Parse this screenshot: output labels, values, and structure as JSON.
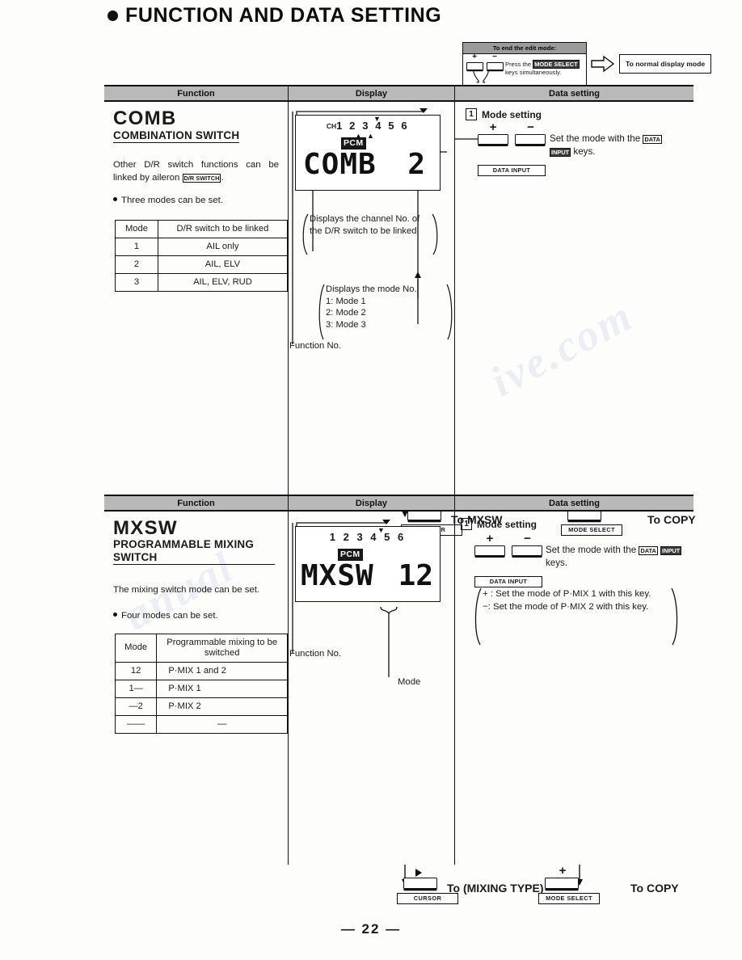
{
  "page": {
    "title": "FUNCTION AND DATA SETTING",
    "page_number": "— 22 —",
    "watermark": "chanialive.com"
  },
  "end_edit_note": {
    "header": "To end the edit mode:",
    "line1_pre": "Press the",
    "key_label": "MODE SELECT",
    "line2": "keys simultaneously.",
    "plus": "+",
    "minus": "−",
    "result_box": "To normal display mode"
  },
  "columns": {
    "function": "Function",
    "display": "Display",
    "data_setting": "Data setting"
  },
  "sections": [
    {
      "code": "COMB",
      "name": "COMBINATION SWITCH",
      "description": "Other D/R switch functions can be linked by aileron",
      "description_key": "D/R SWITCH",
      "description_tail": ".",
      "bullet": "Three modes can be set.",
      "mode_table": {
        "headers": [
          "Mode",
          "D/R switch to be linked"
        ],
        "rows": [
          [
            "1",
            "AIL only"
          ],
          [
            "2",
            "AIL, ELV"
          ],
          [
            "3",
            "AIL, ELV, RUD"
          ]
        ]
      },
      "lcd": {
        "ch_tag": "CH",
        "channels": "1 2 3 4 5 6",
        "pcm": "PCM",
        "segment_name": "COMB",
        "segment_value": "2"
      },
      "callouts": [
        "Displays the channel No. of the D/R switch to be linked.",
        "Displays the mode No.\n1: Mode 1\n2: Mode 2\n3: Mode 3"
      ],
      "function_no_label": "Function No.",
      "mode_pointer_label": "",
      "data_setting": {
        "step_number": "1",
        "step_label": "Mode setting",
        "plus": "+",
        "minus": "−",
        "key_label": "DATA INPUT",
        "instruction_pre": "Set the mode with the",
        "instruction_key1": "DATA",
        "instruction_key2": "INPUT",
        "instruction_tail": "keys.",
        "extra_note": ""
      },
      "nav": {
        "cursor_label": "CURSOR",
        "cursor_to": "To MXSW",
        "mode_select_sign": "+",
        "mode_select_label": "MODE SELECT",
        "mode_select_to": "To COPY"
      }
    },
    {
      "code": "MXSW",
      "name": "PROGRAMMABLE MIXING SWITCH",
      "description": "The mixing switch mode can be set.",
      "description_key": "",
      "description_tail": "",
      "bullet": "Four modes can be set.",
      "mode_table": {
        "headers": [
          "Mode",
          "Programmable mixing to be switched"
        ],
        "rows": [
          [
            "12",
            "P·MIX 1 and 2"
          ],
          [
            "1—",
            "P·MIX 1"
          ],
          [
            "—2",
            "P·MIX 2"
          ],
          [
            "——",
            "—"
          ]
        ]
      },
      "lcd": {
        "ch_tag": "",
        "channels": "1 2 3 4 5 6",
        "pcm": "PCM",
        "segment_name": "MXSW",
        "segment_value": "12"
      },
      "callouts": [
        "+ : Set the mode of P·MIX 1 with this key.\n− : Set the mode of P·MIX 2 with this key."
      ],
      "function_no_label": "Function No.",
      "mode_pointer_label": "Mode",
      "data_setting": {
        "step_number": "1",
        "step_label": "Mode setting",
        "plus": "+",
        "minus": "−",
        "key_label": "DATA INPUT",
        "instruction_pre": "Set the mode with the",
        "instruction_key1": "DATA",
        "instruction_key2": "INPUT",
        "instruction_tail": "keys.",
        "note_plus": "+ : Set the mode of P·MIX 1 with this key.",
        "note_minus": "−: Set the mode of P·MIX 2 with this key."
      },
      "nav": {
        "cursor_label": "CURSOR",
        "cursor_to": "To (MIXING TYPE)",
        "mode_select_sign": "+",
        "mode_select_label": "MODE SELECT",
        "mode_select_to": "To COPY"
      }
    }
  ]
}
